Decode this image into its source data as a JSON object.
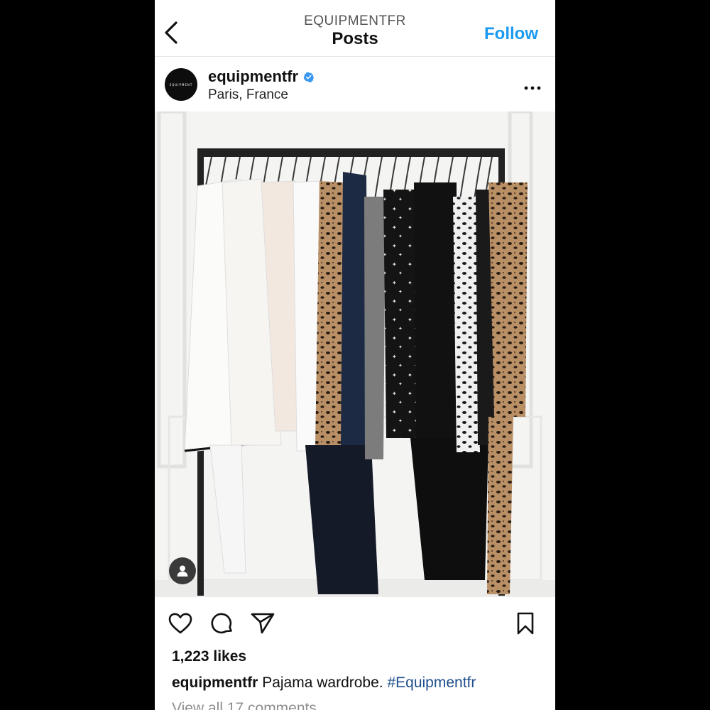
{
  "header": {
    "account_label": "EQUIPMENTFR",
    "title": "Posts",
    "follow_label": "Follow"
  },
  "post": {
    "avatar_text": "EQUIPMENT",
    "username": "equipmentfr",
    "verified": true,
    "location": "Paris, France",
    "likes": "1,223 likes",
    "caption_user": "equipmentfr",
    "caption_text": "Pajama wardrobe.",
    "caption_hashtag": "#Equipmentfr",
    "comments_link": "View all 17 comments"
  },
  "icons": {
    "back": "chevron-left-icon",
    "more": "ellipsis-icon",
    "tag": "user-tag-icon",
    "like": "heart-icon",
    "comment": "comment-bubble-icon",
    "share": "paper-plane-icon",
    "save": "bookmark-icon"
  },
  "colors": {
    "accent": "#1a99f0",
    "verified": "#3897f0",
    "hashtag": "#1f4f8c",
    "muted": "#8e8e8e"
  }
}
